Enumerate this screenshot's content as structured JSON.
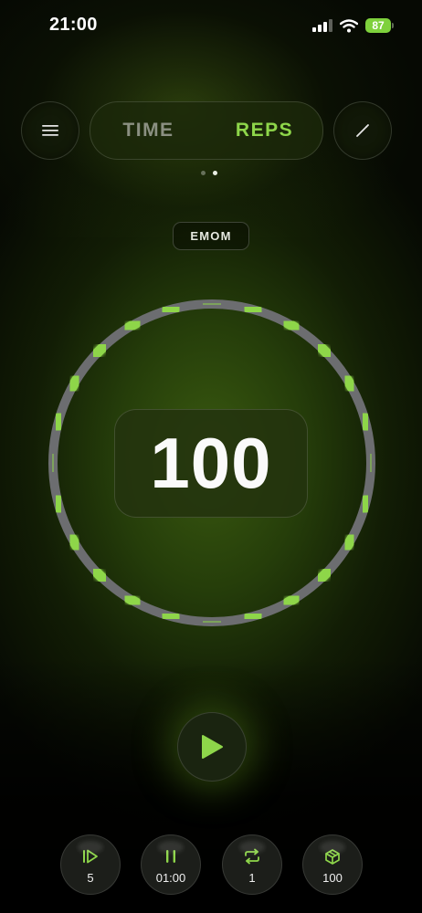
{
  "status_bar": {
    "time": "21:00",
    "battery": "87",
    "icons": [
      "signal-icon",
      "wifi-icon",
      "battery-icon"
    ]
  },
  "header": {
    "menu_icon": "hamburger-menu-icon",
    "edit_icon": "pencil-icon",
    "mode_toggle": {
      "options": [
        "TIME",
        "REPS"
      ],
      "selected": "REPS"
    }
  },
  "pager": {
    "count": 2,
    "active_index": 1
  },
  "mode_tag": "EMOM",
  "counter": {
    "value": "100"
  },
  "ring": {
    "segments": 24,
    "active_color": "#8ed64a",
    "track_color": "#6c6d70"
  },
  "play_icon": "play-icon",
  "stats": [
    {
      "icon": "step-forward-icon",
      "value": "5"
    },
    {
      "icon": "pause-icon",
      "value": "01:00"
    },
    {
      "icon": "repeat-icon",
      "value": "1"
    },
    {
      "icon": "stack-icon",
      "value": "100"
    }
  ],
  "colors": {
    "accent": "#8ed64a",
    "background": "#0b1205"
  }
}
